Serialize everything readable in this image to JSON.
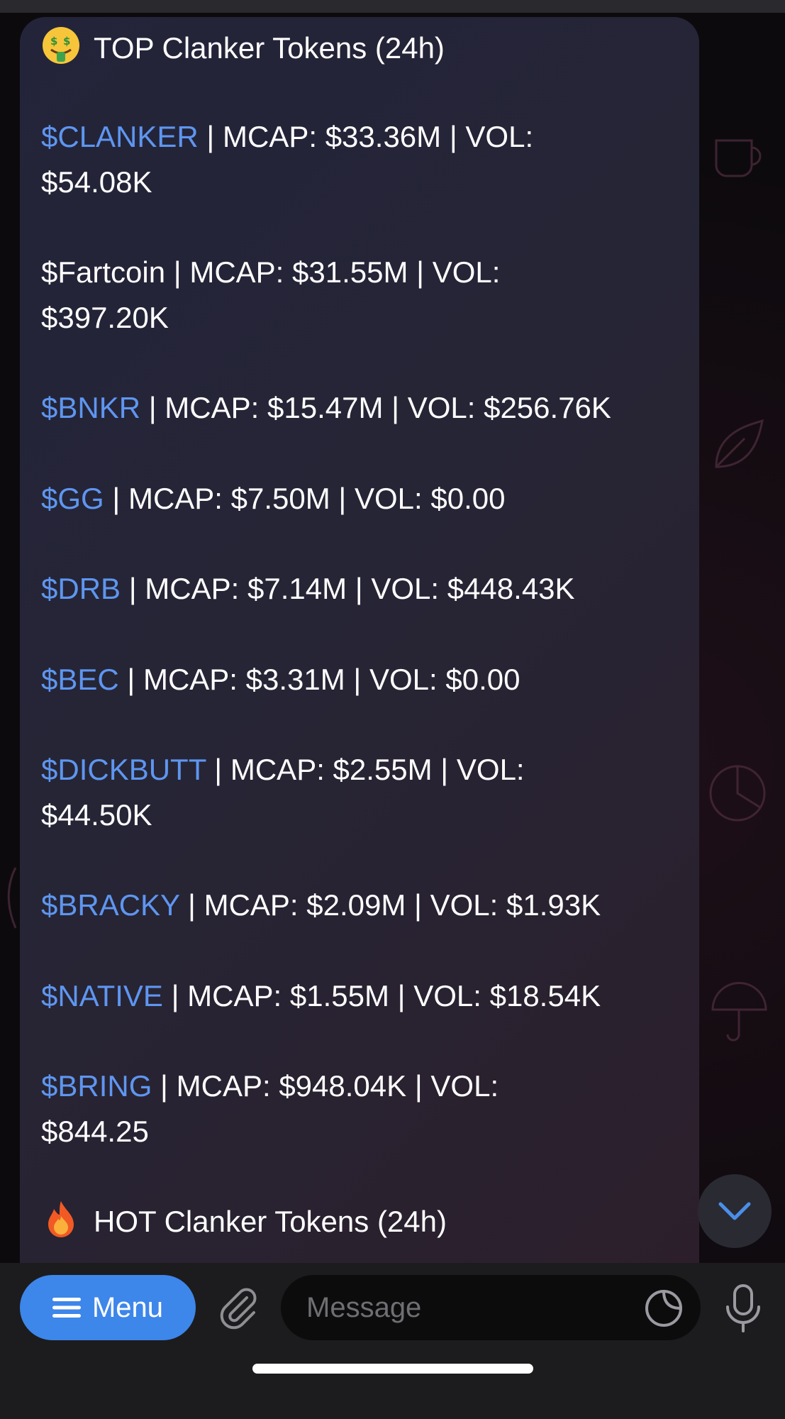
{
  "chat": {
    "top_header": "TOP Clanker Tokens (24h)",
    "top_header_emoji": "money-mouth-face",
    "sep_mcap": " | MCAP: ",
    "sep_vol": " | VOL: ",
    "tokens": [
      {
        "ticker": "$CLANKER",
        "mcap": "$33.36M",
        "vol": "$54.08K"
      },
      {
        "ticker": "$Fartcoin",
        "mcap": "$31.55M",
        "vol": "$397.20K"
      },
      {
        "ticker": "$BNKR",
        "mcap": "$15.47M",
        "vol": "$256.76K"
      },
      {
        "ticker": "$GG",
        "mcap": "$7.50M",
        "vol": "$0.00"
      },
      {
        "ticker": "$DRB",
        "mcap": "$7.14M",
        "vol": "$448.43K"
      },
      {
        "ticker": "$BEC",
        "mcap": "$3.31M",
        "vol": "$0.00"
      },
      {
        "ticker": "$DICKBUTT",
        "mcap": "$2.55M",
        "vol": "$44.50K"
      },
      {
        "ticker": "$BRACKY",
        "mcap": "$2.09M",
        "vol": "$1.93K"
      },
      {
        "ticker": "$NATIVE",
        "mcap": "$1.55M",
        "vol": "$18.54K"
      },
      {
        "ticker": "$BRING",
        "mcap": "$948.04K",
        "vol": "$844.25"
      }
    ],
    "hot_header": "HOT Clanker Tokens (24h)",
    "hot_header_emoji": "fire"
  },
  "composer": {
    "menu_label": "Menu",
    "message_placeholder": "Message"
  },
  "colors": {
    "ticker_link": "#5e96f0",
    "menu_button": "#3d86ea",
    "bubble": "#25253a"
  },
  "icons": [
    "money-mouth-face-icon",
    "fire-icon",
    "chevron-down-icon",
    "hamburger-icon",
    "paperclip-icon",
    "sticker-icon",
    "microphone-icon"
  ]
}
